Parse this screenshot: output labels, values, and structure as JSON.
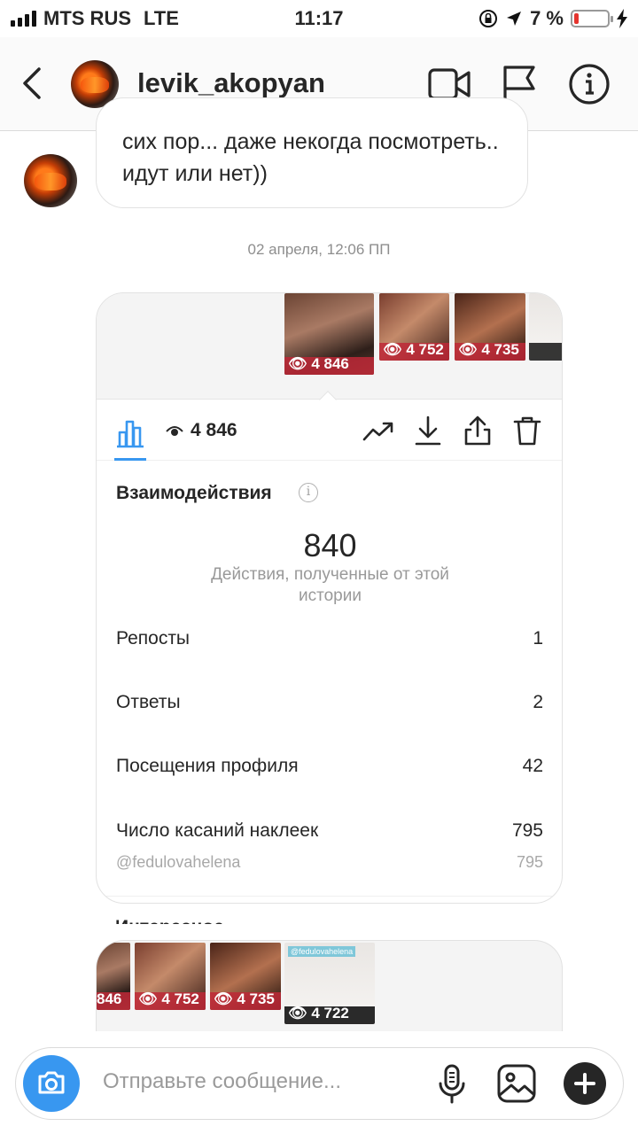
{
  "status_bar": {
    "carrier": "MTS RUS",
    "network": "LTE",
    "time": "11:17",
    "battery_percent": "7 %",
    "battery_level": 0.07
  },
  "header": {
    "username": "levik_akopyan",
    "icons": [
      "back-chevron-icon",
      "video-call-icon",
      "flag-icon",
      "info-icon"
    ]
  },
  "chat": {
    "message_text": "сих пор... даже некогда посмотреть.. идут или нет))",
    "timestamp": "02 апреля, 12:06 ПП"
  },
  "story_card": {
    "thumbnails": [
      {
        "views": "4 846",
        "selected": true
      },
      {
        "views": "4 752"
      },
      {
        "views": "4 735"
      },
      {
        "views": ""
      }
    ],
    "toolbar": {
      "views": "4 846",
      "icons": [
        "bar-chart-icon",
        "eye-icon",
        "trending-icon",
        "download-icon",
        "share-icon",
        "trash-icon"
      ]
    },
    "interactions": {
      "title": "Взаимодействия",
      "total": "840",
      "total_caption": "Действия, полученные от этой истории",
      "rows": [
        {
          "label": "Репосты",
          "value": "1"
        },
        {
          "label": "Ответы",
          "value": "2"
        },
        {
          "label": "Посещения профиля",
          "value": "42"
        },
        {
          "label": "Число касаний наклеек",
          "value": "795"
        }
      ],
      "sticker_row": {
        "label": "@fedulovahelena",
        "value": "795"
      }
    },
    "next_section_title": "Интересное"
  },
  "story_card_2": {
    "thumbnails": [
      {
        "views": "846"
      },
      {
        "views": "4 752"
      },
      {
        "views": "4 735"
      },
      {
        "views": "4 722",
        "selected": true,
        "tag": "@fedulovahelena"
      }
    ]
  },
  "composer": {
    "placeholder": "Отправьте сообщение..."
  },
  "colors": {
    "accent_blue": "#3897f0",
    "text": "#262626",
    "muted": "#8e8e8e",
    "battery_low": "#e5342e"
  }
}
